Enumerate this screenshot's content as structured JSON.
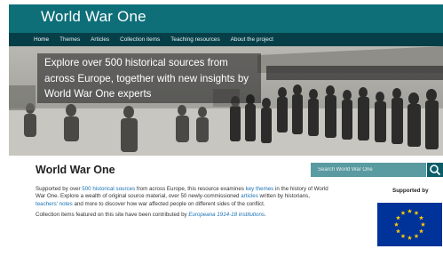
{
  "header": {
    "title": "World War One"
  },
  "nav": {
    "items": [
      {
        "label": "Home"
      },
      {
        "label": "Themes"
      },
      {
        "label": "Articles"
      },
      {
        "label": "Collection items"
      },
      {
        "label": "Teaching resources"
      },
      {
        "label": "About the project"
      }
    ]
  },
  "hero": {
    "caption": "Explore over 500 historical sources from across Europe, together with new insights by World War One experts"
  },
  "main": {
    "heading": "World War One"
  },
  "search": {
    "placeholder": "Search World War One"
  },
  "intro": {
    "p1": [
      {
        "text": "Supported by over "
      },
      {
        "text": "500 historical sources",
        "link": true
      },
      {
        "text": " from across Europe, this resource examines "
      },
      {
        "text": "key themes",
        "link": true
      },
      {
        "text": " in the history of World War One. Explore a wealth of original source material, over 50 newly-commissioned "
      },
      {
        "text": "articles",
        "link": true
      },
      {
        "text": " written by historians, "
      },
      {
        "text": "teachers' notes",
        "link": true
      },
      {
        "text": " and more to discover how war affected people on different sides of the conflict."
      }
    ],
    "p2": [
      {
        "text": "Collection items featured on this site have been contributed by "
      },
      {
        "text": "Europeana 1914-18 institutions",
        "link": true,
        "italic": true
      },
      {
        "text": "."
      }
    ]
  },
  "sidebar": {
    "supported_by": "Supported by"
  },
  "colors": {
    "header_bg": "#0e6f79",
    "nav_bg": "#073f48",
    "search_bg": "#5a9aa1",
    "link": "#1b73b4",
    "eu_blue": "#003399",
    "eu_star": "#ffcc00"
  },
  "icons": {
    "search": "search-icon",
    "flag": "eu-flag-icon"
  }
}
